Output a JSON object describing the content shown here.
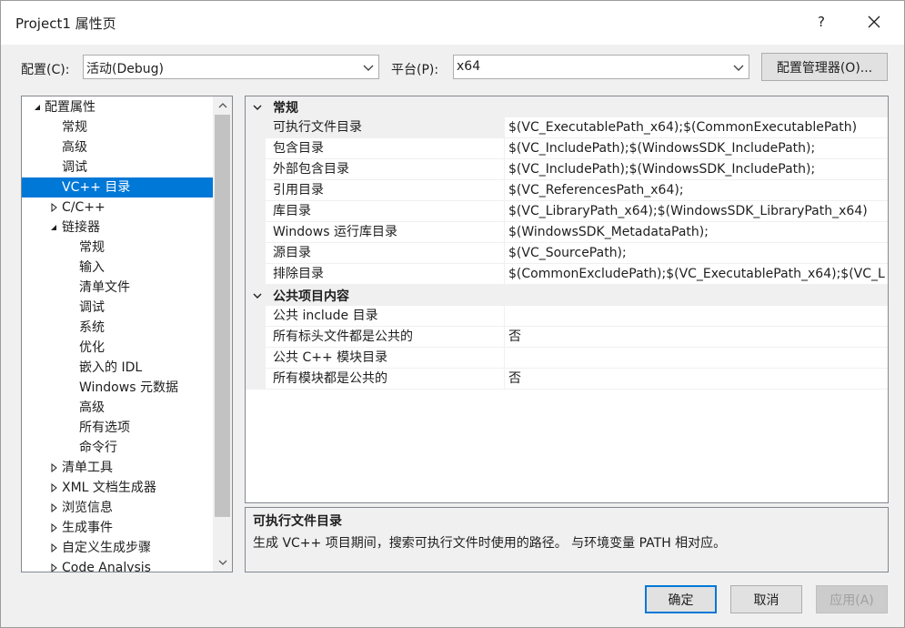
{
  "window": {
    "title": "Project1 属性页",
    "help": "?"
  },
  "config": {
    "config_label": "配置(C):",
    "config_value": "活动(Debug)",
    "platform_label": "平台(P):",
    "platform_value": "x64",
    "manager_button": "配置管理器(O)..."
  },
  "tree": {
    "items": [
      {
        "label": "配置属性",
        "expander": "expanded"
      },
      {
        "label": "常规",
        "expander": "none"
      },
      {
        "label": "高级",
        "expander": "none"
      },
      {
        "label": "调试",
        "expander": "none"
      },
      {
        "label": "VC++ 目录",
        "expander": "none",
        "selected": true
      },
      {
        "label": "C/C++",
        "expander": "collapsed"
      },
      {
        "label": "链接器",
        "expander": "expanded"
      },
      {
        "label": "常规",
        "expander": "none"
      },
      {
        "label": "输入",
        "expander": "none"
      },
      {
        "label": "清单文件",
        "expander": "none"
      },
      {
        "label": "调试",
        "expander": "none"
      },
      {
        "label": "系统",
        "expander": "none"
      },
      {
        "label": "优化",
        "expander": "none"
      },
      {
        "label": "嵌入的 IDL",
        "expander": "none"
      },
      {
        "label": "Windows 元数据",
        "expander": "none"
      },
      {
        "label": "高级",
        "expander": "none"
      },
      {
        "label": "所有选项",
        "expander": "none"
      },
      {
        "label": "命令行",
        "expander": "none"
      },
      {
        "label": "清单工具",
        "expander": "collapsed"
      },
      {
        "label": "XML 文档生成器",
        "expander": "collapsed"
      },
      {
        "label": "浏览信息",
        "expander": "collapsed"
      },
      {
        "label": "生成事件",
        "expander": "collapsed"
      },
      {
        "label": "自定义生成步骤",
        "expander": "collapsed"
      },
      {
        "label": "Code Analysis",
        "expander": "collapsed"
      }
    ]
  },
  "grid": {
    "categories": [
      {
        "name": "常规",
        "rows": [
          {
            "name": "可执行文件目录",
            "value": "$(VC_ExecutablePath_x64);$(CommonExecutablePath)"
          },
          {
            "name": "包含目录",
            "value": "$(VC_IncludePath);$(WindowsSDK_IncludePath);"
          },
          {
            "name": "外部包含目录",
            "value": "$(VC_IncludePath);$(WindowsSDK_IncludePath);"
          },
          {
            "name": "引用目录",
            "value": "$(VC_ReferencesPath_x64);"
          },
          {
            "name": "库目录",
            "value": "$(VC_LibraryPath_x64);$(WindowsSDK_LibraryPath_x64)"
          },
          {
            "name": "Windows 运行库目录",
            "value": "$(WindowsSDK_MetadataPath);"
          },
          {
            "name": "源目录",
            "value": "$(VC_SourcePath);"
          },
          {
            "name": "排除目录",
            "value": "$(CommonExcludePath);$(VC_ExecutablePath_x64);$(VC_L"
          }
        ]
      },
      {
        "name": "公共项目内容",
        "rows": [
          {
            "name": "公共 include 目录",
            "value": ""
          },
          {
            "name": "所有标头文件都是公共的",
            "value": "否"
          },
          {
            "name": "公共 C++ 模块目录",
            "value": ""
          },
          {
            "name": "所有模块都是公共的",
            "value": "否"
          }
        ]
      }
    ]
  },
  "description": {
    "title": "可执行文件目录",
    "text": "生成 VC++ 项目期间，搜索可执行文件时使用的路径。 与环境变量 PATH 相对应。"
  },
  "buttons": {
    "ok": "确定",
    "cancel": "取消",
    "apply": "应用(A)"
  },
  "icons": {
    "close": "close-icon",
    "dropdown": "chevron-down-icon",
    "tree_expanded": "triangle-expanded-icon",
    "tree_collapsed": "triangle-collapsed-icon",
    "category": "chevron-down-icon",
    "scroll_up": "scroll-up-icon",
    "scroll_down": "scroll-down-icon"
  },
  "colors": {
    "selection": "#0078d7",
    "background": "#f0f0f0",
    "default_button_border": "#0078d7"
  }
}
